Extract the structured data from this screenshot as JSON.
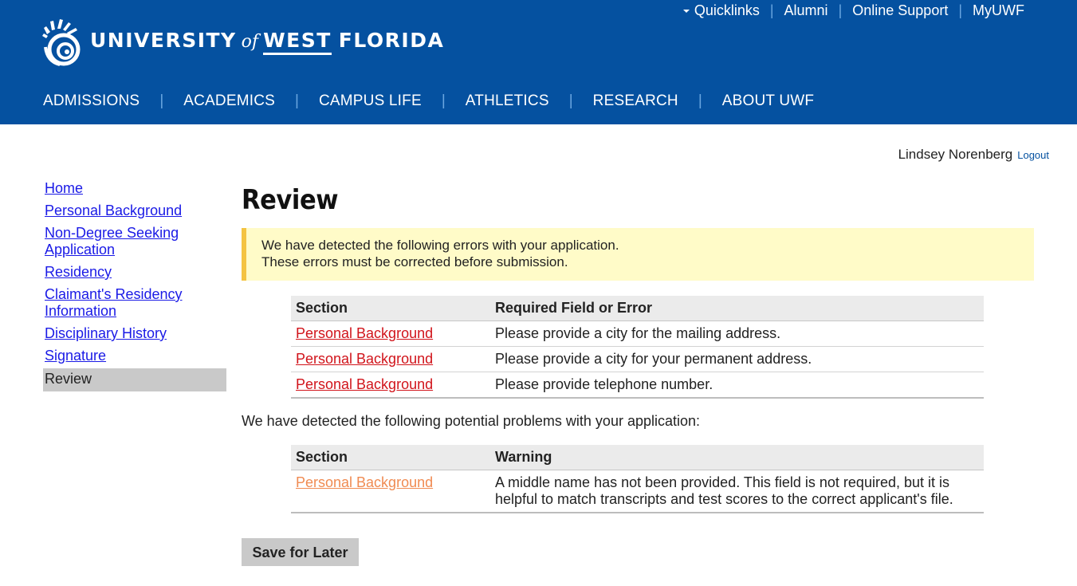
{
  "header": {
    "logo": {
      "word1": "UNIVERSITY",
      "word2": "of",
      "word3": "WEST",
      "word4": "FLORIDA"
    },
    "utility_links": [
      "Quicklinks",
      "Alumni",
      "Online Support",
      "MyUWF"
    ],
    "nav": [
      "ADMISSIONS",
      "ACADEMICS",
      "CAMPUS LIFE",
      "ATHLETICS",
      "RESEARCH",
      "ABOUT UWF"
    ],
    "colors": {
      "brand_blue": "#0551a0",
      "separator": "#6aa6e0"
    }
  },
  "user": {
    "name": "Lindsey Norenberg",
    "logout": "Logout"
  },
  "sidebar": {
    "items": [
      {
        "label": "Home"
      },
      {
        "label": "Personal Background"
      },
      {
        "label": "Non-Degree Seeking Application"
      },
      {
        "label": "Residency"
      },
      {
        "label": "Claimant's Residency Information"
      },
      {
        "label": "Disciplinary History"
      },
      {
        "label": "Signature"
      },
      {
        "label": "Review",
        "active": true
      }
    ]
  },
  "main": {
    "title": "Review",
    "alert": {
      "line1": "We have detected the following errors with your application.",
      "line2": "These errors must be corrected before submission."
    },
    "errors_table": {
      "headers": [
        "Section",
        "Required Field or Error"
      ],
      "rows": [
        [
          "Personal Background",
          "Please provide a city for the mailing address."
        ],
        [
          "Personal Background",
          "Please provide a city for your permanent address."
        ],
        [
          "Personal Background",
          "Please provide telephone number."
        ]
      ]
    },
    "warnings_intro": "We have detected the following potential problems with your application:",
    "warnings_table": {
      "headers": [
        "Section",
        "Warning"
      ],
      "rows": [
        [
          "Personal Background",
          "A middle name has not been provided. This field is not required, but it is helpful to match transcripts and test scores to the correct applicant's file."
        ]
      ]
    },
    "save_button": "Save for Later"
  }
}
